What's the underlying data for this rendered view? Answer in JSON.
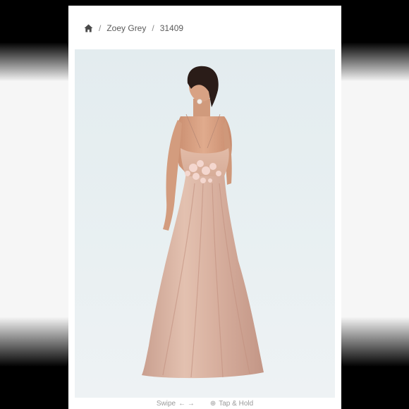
{
  "breadcrumb": {
    "home_icon": "home-icon",
    "items": [
      "Zoey Grey",
      "31409"
    ],
    "separator": "/"
  },
  "product_image": {
    "alt": "Zoey Grey 31409"
  },
  "hints": {
    "swipe_label": "Swipe",
    "swipe_arrows": "← →",
    "tap_label": "Tap & Hold",
    "tap_icon": "plus-circle-icon"
  },
  "colors": {
    "accent": "#d9b5a6",
    "text": "#5a5a5a"
  }
}
